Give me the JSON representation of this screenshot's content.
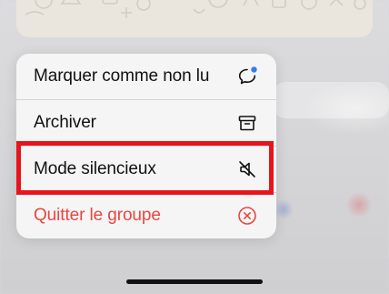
{
  "menu": {
    "items": [
      {
        "label": "Marquer comme non lu",
        "icon": "chat-bubble-unread-icon"
      },
      {
        "label": "Archiver",
        "icon": "archive-box-icon"
      },
      {
        "label": "Mode silencieux",
        "icon": "speaker-muted-icon"
      },
      {
        "label": "Quitter le groupe",
        "icon": "close-circle-icon",
        "destructive": true
      }
    ]
  },
  "colors": {
    "destructive": "#e8463f",
    "unread_dot": "#2f7cf6",
    "highlight_box": "#e8141c",
    "menu_background": "#f5f5f6"
  }
}
